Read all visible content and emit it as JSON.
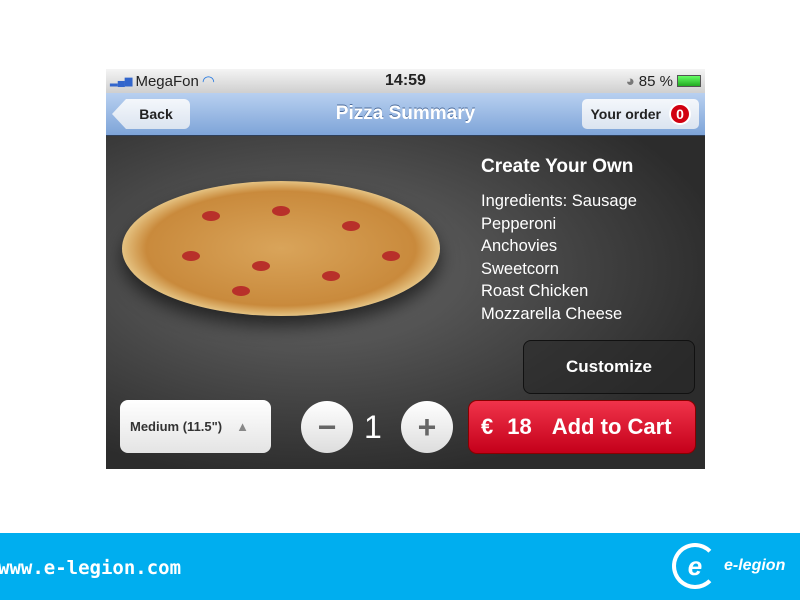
{
  "status": {
    "carrier": "MegaFon",
    "time": "14:59",
    "battery": "85 %",
    "battery_level": 85
  },
  "nav": {
    "back": "Back",
    "title": "Pizza Summary",
    "order_label": "Your order",
    "order_count": "0"
  },
  "pizza": {
    "name": "Create Your Own",
    "ingredients": [
      "Ingredients: Sausage",
      "Pepperoni",
      "Anchovies",
      "Sweetcorn",
      "Roast Chicken",
      "Mozzarella Cheese"
    ]
  },
  "customize": "Customize",
  "size": "Medium (11.5\")",
  "quantity": "1",
  "cart": {
    "currency": "€",
    "price": "18",
    "label": "Add to Cart"
  },
  "footer": {
    "url": "www.e-legion.com",
    "logo": "e-legion"
  },
  "colors": {
    "accent_red": "#d10010",
    "footer": "#00aeef"
  }
}
